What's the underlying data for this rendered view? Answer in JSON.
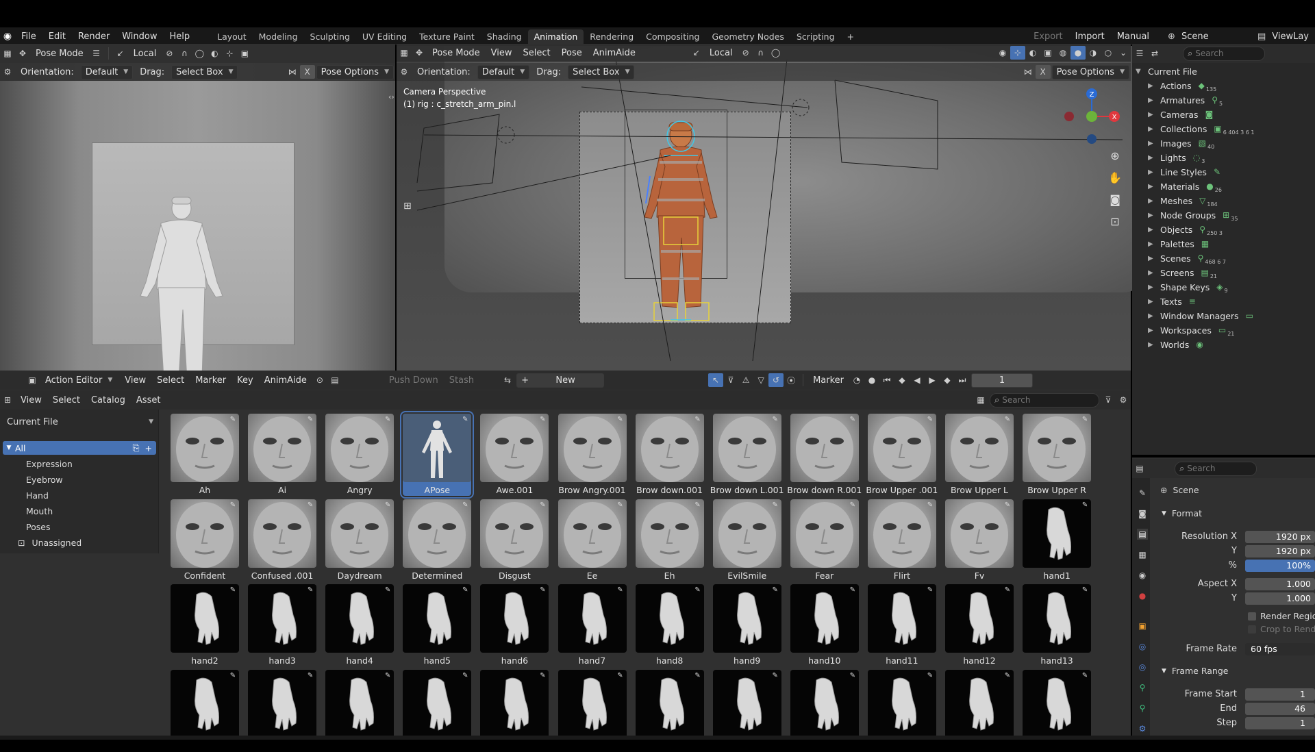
{
  "menu": {
    "items": [
      "File",
      "Edit",
      "Render",
      "Window",
      "Help"
    ]
  },
  "workspaces": {
    "tabs": [
      "Layout",
      "Modeling",
      "Sculpting",
      "UV Editing",
      "Texture Paint",
      "Shading",
      "Animation",
      "Rendering",
      "Compositing",
      "Geometry Nodes",
      "Scripting"
    ],
    "active": "Animation",
    "add": "+"
  },
  "topright": {
    "export": "Export",
    "import": "Import",
    "manual": "Manual",
    "scene": "Scene",
    "viewlayer": "ViewLay"
  },
  "left_viewport": {
    "mode": "Pose Mode",
    "transform": "Local",
    "orientation_label": "Orientation:",
    "orientation": "Default",
    "drag_label": "Drag:",
    "drag": "Select Box",
    "x": "X",
    "pose_options": "Pose Options"
  },
  "main_viewport": {
    "mode": "Pose Mode",
    "menus": [
      "View",
      "Select",
      "Pose",
      "AnimAide"
    ],
    "transform": "Local",
    "orientation_label": "Orientation:",
    "orientation": "Default",
    "drag_label": "Drag:",
    "drag": "Select Box",
    "x": "X",
    "pose_options": "Pose Options",
    "info_line1": "Camera Perspective",
    "info_line2": "(1) rig : c_stretch_arm_pin.l"
  },
  "outliner": {
    "search_placeholder": "Search",
    "root": "Current File",
    "items": [
      {
        "label": "Actions",
        "badge": "135"
      },
      {
        "label": "Armatures",
        "badge": "5"
      },
      {
        "label": "Cameras",
        "badge": ""
      },
      {
        "label": "Collections",
        "badge": "6 404 3 6 1"
      },
      {
        "label": "Images",
        "badge": "40"
      },
      {
        "label": "Lights",
        "badge": "3"
      },
      {
        "label": "Line Styles",
        "badge": ""
      },
      {
        "label": "Materials",
        "badge": "26"
      },
      {
        "label": "Meshes",
        "badge": "184"
      },
      {
        "label": "Node Groups",
        "badge": "35"
      },
      {
        "label": "Objects",
        "badge": "250 3"
      },
      {
        "label": "Palettes",
        "badge": ""
      },
      {
        "label": "Scenes",
        "badge": "468 6 7"
      },
      {
        "label": "Screens",
        "badge": "21"
      },
      {
        "label": "Shape Keys",
        "badge": "9"
      },
      {
        "label": "Texts",
        "badge": ""
      },
      {
        "label": "Window Managers",
        "badge": ""
      },
      {
        "label": "Workspaces",
        "badge": "21"
      },
      {
        "label": "Worlds",
        "badge": ""
      }
    ]
  },
  "action_editor": {
    "editor": "Action Editor",
    "menus": [
      "View",
      "Select",
      "Marker",
      "Key",
      "AnimAide"
    ],
    "push_down": "Push Down",
    "stash": "Stash",
    "new": "New",
    "marker": "Marker",
    "frame": "1"
  },
  "asset_browser": {
    "menus": [
      "View",
      "Select",
      "Catalog",
      "Asset"
    ],
    "library": "Current File",
    "search_placeholder": "Search",
    "catalogs": {
      "all": "All",
      "items": [
        "Expression",
        "Eyebrow",
        "Hand",
        "Mouth",
        "Poses"
      ],
      "unassigned": "Unassigned"
    },
    "assets": [
      {
        "name": "Ah",
        "kind": "face"
      },
      {
        "name": "Ai",
        "kind": "face"
      },
      {
        "name": "Angry",
        "kind": "face"
      },
      {
        "name": "APose",
        "kind": "pose"
      },
      {
        "name": "Awe.001",
        "kind": "face"
      },
      {
        "name": "Brow Angry.001",
        "kind": "face"
      },
      {
        "name": "Brow down.001",
        "kind": "face"
      },
      {
        "name": "Brow down L.001",
        "kind": "face"
      },
      {
        "name": "Brow down R.001",
        "kind": "face"
      },
      {
        "name": "Brow Upper .001",
        "kind": "face"
      },
      {
        "name": "Brow Upper L",
        "kind": "face"
      },
      {
        "name": "Brow Upper R",
        "kind": "face"
      },
      {
        "name": "Confident",
        "kind": "face"
      },
      {
        "name": "Confused .001",
        "kind": "face"
      },
      {
        "name": "Daydream",
        "kind": "face"
      },
      {
        "name": "Determined",
        "kind": "face"
      },
      {
        "name": "Disgust",
        "kind": "face"
      },
      {
        "name": "Ee",
        "kind": "face"
      },
      {
        "name": "Eh",
        "kind": "face"
      },
      {
        "name": "EvilSmile",
        "kind": "face"
      },
      {
        "name": "Fear",
        "kind": "face"
      },
      {
        "name": "Flirt",
        "kind": "face"
      },
      {
        "name": "Fv",
        "kind": "face"
      },
      {
        "name": "hand1",
        "kind": "hand"
      },
      {
        "name": "hand2",
        "kind": "hand"
      },
      {
        "name": "hand3",
        "kind": "hand"
      },
      {
        "name": "hand4",
        "kind": "hand"
      },
      {
        "name": "hand5",
        "kind": "hand"
      },
      {
        "name": "hand6",
        "kind": "hand"
      },
      {
        "name": "hand7",
        "kind": "hand"
      },
      {
        "name": "hand8",
        "kind": "hand"
      },
      {
        "name": "hand9",
        "kind": "hand"
      },
      {
        "name": "hand10",
        "kind": "hand"
      },
      {
        "name": "hand11",
        "kind": "hand"
      },
      {
        "name": "hand12",
        "kind": "hand"
      },
      {
        "name": "hand13",
        "kind": "hand"
      },
      {
        "name": "",
        "kind": "hand"
      },
      {
        "name": "",
        "kind": "hand"
      },
      {
        "name": "",
        "kind": "hand"
      },
      {
        "name": "",
        "kind": "hand"
      },
      {
        "name": "",
        "kind": "hand"
      },
      {
        "name": "",
        "kind": "hand"
      },
      {
        "name": "",
        "kind": "hand"
      },
      {
        "name": "",
        "kind": "hand"
      },
      {
        "name": "",
        "kind": "hand"
      },
      {
        "name": "",
        "kind": "hand"
      },
      {
        "name": "",
        "kind": "hand"
      },
      {
        "name": "",
        "kind": "hand"
      }
    ],
    "selected": "APose"
  },
  "properties": {
    "search_placeholder": "Search",
    "scene": "Scene",
    "format_panel": "Format",
    "res_x_label": "Resolution X",
    "res_x": "1920 px",
    "res_y_label": "Y",
    "res_y": "1920 px",
    "pct_label": "%",
    "pct": "100%",
    "aspect_x_label": "Aspect X",
    "aspect_x": "1.000",
    "aspect_y_label": "Y",
    "aspect_y": "1.000",
    "render_region": "Render Region",
    "crop": "Crop to Render",
    "frame_rate_label": "Frame Rate",
    "frame_rate": "60 fps",
    "frame_range_panel": "Frame Range",
    "frame_start_label": "Frame Start",
    "frame_start": "1",
    "end_label": "End",
    "end": "46",
    "step_label": "Step",
    "step": "1"
  },
  "colors": {
    "accent": "#4772b3",
    "bg_panel": "#303030",
    "header": "#2c2c2c"
  }
}
